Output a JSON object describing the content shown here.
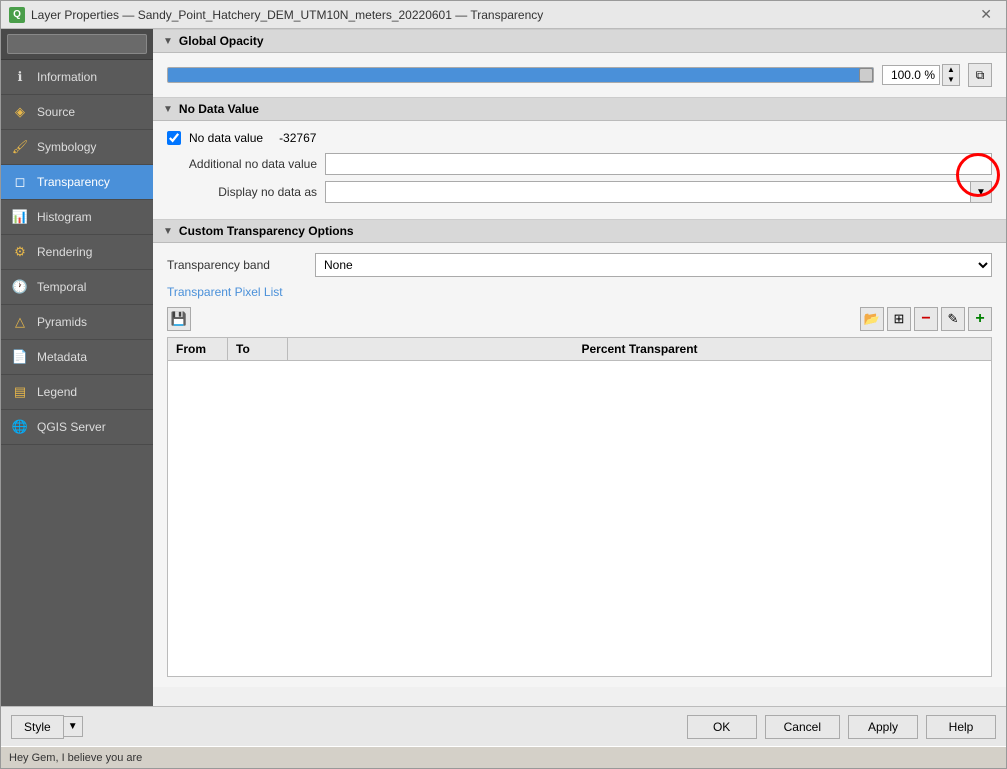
{
  "window": {
    "title": "Layer Properties — Sandy_Point_Hatchery_DEM_UTM10N_meters_20220601 — Transparency",
    "icon": "Q"
  },
  "search": {
    "placeholder": ""
  },
  "sidebar": {
    "items": [
      {
        "id": "information",
        "label": "Information",
        "icon": "ℹ",
        "active": false
      },
      {
        "id": "source",
        "label": "Source",
        "icon": "◈",
        "active": false
      },
      {
        "id": "symbology",
        "label": "Symbology",
        "icon": "🎨",
        "active": false
      },
      {
        "id": "transparency",
        "label": "Transparency",
        "icon": "◻",
        "active": true
      },
      {
        "id": "histogram",
        "label": "Histogram",
        "icon": "📊",
        "active": false
      },
      {
        "id": "rendering",
        "label": "Rendering",
        "icon": "⚙",
        "active": false
      },
      {
        "id": "temporal",
        "label": "Temporal",
        "icon": "🕐",
        "active": false
      },
      {
        "id": "pyramids",
        "label": "Pyramids",
        "icon": "△",
        "active": false
      },
      {
        "id": "metadata",
        "label": "Metadata",
        "icon": "📄",
        "active": false
      },
      {
        "id": "legend",
        "label": "Legend",
        "icon": "📋",
        "active": false
      },
      {
        "id": "qgis-server",
        "label": "QGIS Server",
        "icon": "🌐",
        "active": false
      }
    ]
  },
  "sections": {
    "global_opacity": {
      "header": "Global Opacity",
      "opacity_value": "100.0 %",
      "slider_pct": 100
    },
    "no_data_value": {
      "header": "No Data Value",
      "checkbox_checked": true,
      "checkbox_label": "No data value",
      "no_data_value": "-32767",
      "additional_label": "Additional no data value",
      "display_label": "Display no data as"
    },
    "custom_transparency": {
      "header": "Custom Transparency Options",
      "band_label": "Transparency band",
      "band_value": "None",
      "pixel_list_label": "Transparent Pixel List",
      "table": {
        "col_from": "From",
        "col_to": "To",
        "col_percent": "Percent Transparent",
        "rows": []
      }
    }
  },
  "toolbar": {
    "save_icon": "💾",
    "open_icon": "📂",
    "table_icon": "⊞",
    "remove_icon": "−",
    "edit_icon": "✎",
    "add_icon": "+"
  },
  "bottom_bar": {
    "style_label": "Style",
    "ok_label": "OK",
    "cancel_label": "Cancel",
    "apply_label": "Apply",
    "help_label": "Help"
  },
  "taskbar": {
    "text": "Hey Gem, I believe you are"
  }
}
